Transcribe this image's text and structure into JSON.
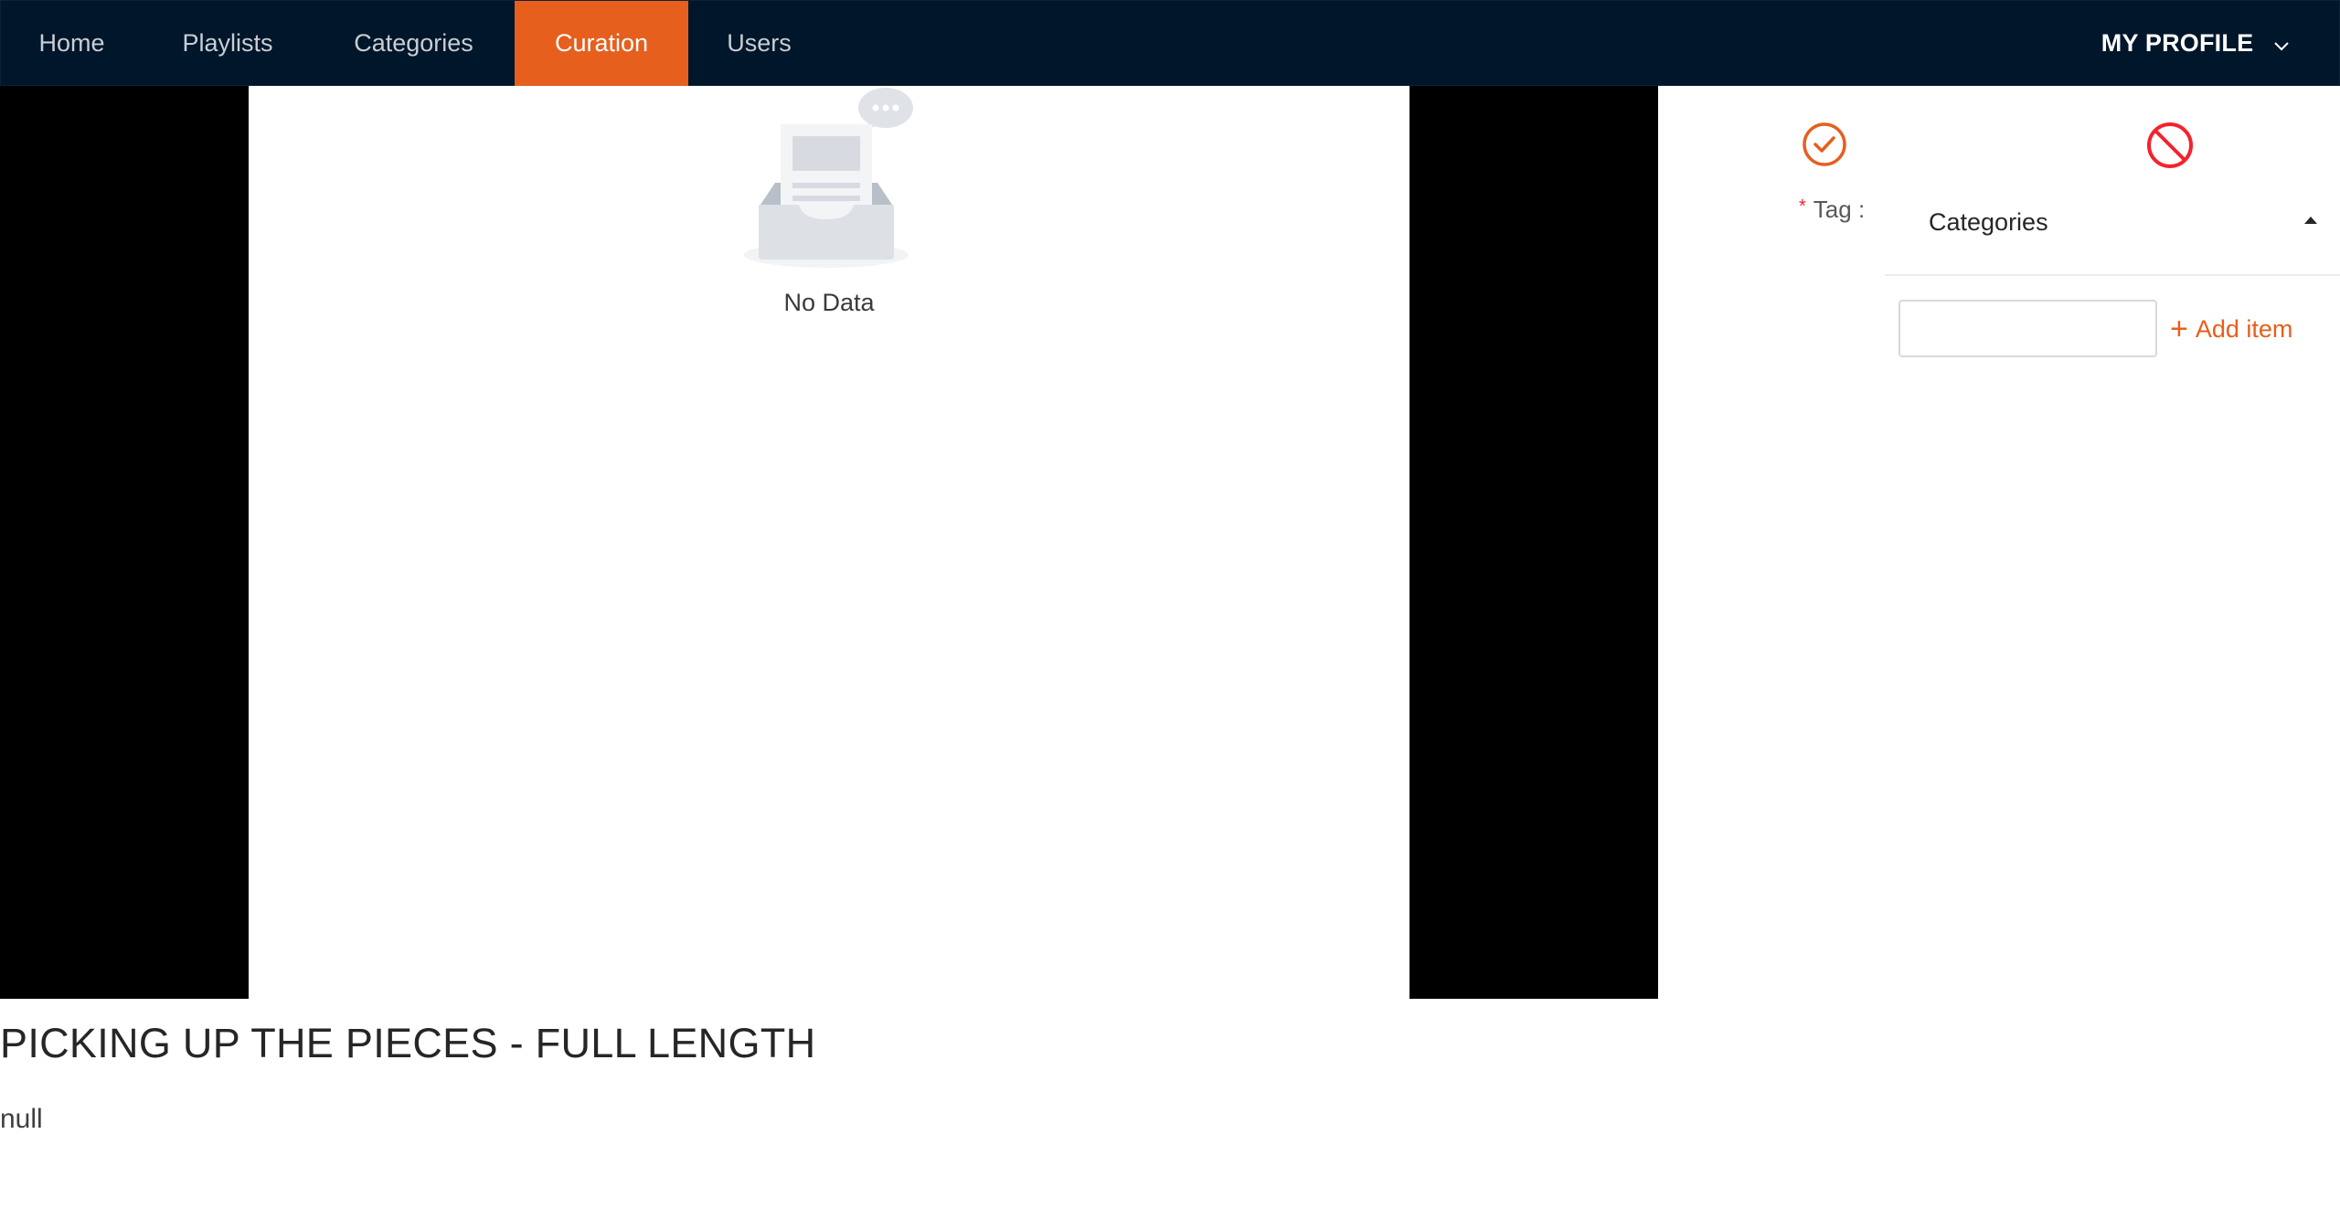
{
  "nav": {
    "items": [
      {
        "label": "Home"
      },
      {
        "label": "Playlists"
      },
      {
        "label": "Categories"
      },
      {
        "label": "Curation",
        "active": true
      },
      {
        "label": "Users"
      }
    ],
    "profile_label": "MY PROFILE"
  },
  "video": {
    "empty_text": "No Data"
  },
  "panel": {
    "tag_label": "Tag",
    "tag_suffix": ":",
    "required_mark": "*",
    "dropdown_label": "Categories",
    "new_item_value": "",
    "add_item_label": "Add item",
    "add_item_icon": "plus-icon",
    "approve_icon": "check-circle-icon",
    "reject_icon": "stop-icon"
  },
  "info": {
    "title": "PICKING UP THE PIECES - FULL LENGTH",
    "description": "null"
  },
  "colors": {
    "nav_bg": "#00162a",
    "accent": "#e65f1d",
    "reject": "#f5222d"
  }
}
